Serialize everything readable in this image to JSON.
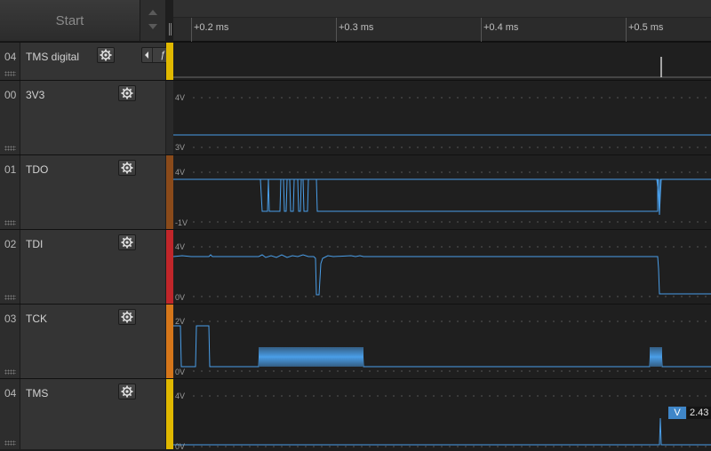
{
  "toolbar": {
    "start_label": "Start"
  },
  "time_ruler": {
    "labels": [
      "+0.2 ms",
      "+0.3 ms",
      "+0.4 ms",
      "+0.5 ms"
    ]
  },
  "channels": [
    {
      "number": "04",
      "name": "TMS digital",
      "type": "digital",
      "edge_symbol": "ƒ",
      "color": "#e0b800"
    },
    {
      "number": "00",
      "name": "3V3",
      "type": "analog",
      "top_label": "4V",
      "bottom_label": "3V",
      "color": "#2a2a2a"
    },
    {
      "number": "01",
      "name": "TDO",
      "type": "analog",
      "top_label": "4V",
      "bottom_label": "-1V",
      "color": "#8a4a1a"
    },
    {
      "number": "02",
      "name": "TDI",
      "type": "analog",
      "top_label": "4V",
      "bottom_label": "0V",
      "color": "#c0262a"
    },
    {
      "number": "03",
      "name": "TCK",
      "type": "analog",
      "top_label": "2V",
      "bottom_label": "0V",
      "color": "#d5761a"
    },
    {
      "number": "04",
      "name": "TMS",
      "type": "analog",
      "top_label": "4V",
      "bottom_label": "0V",
      "color": "#e0b800"
    }
  ],
  "cursor": {
    "badge": "V",
    "value": "2.43"
  },
  "colors": {
    "waveform": "#4a9ee8",
    "background": "#1e1e1e"
  }
}
